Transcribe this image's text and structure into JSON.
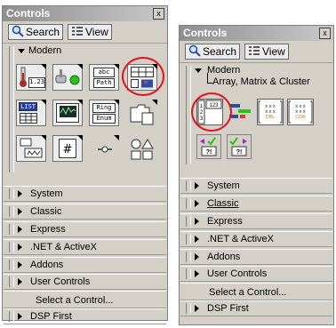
{
  "left_palette": {
    "title": "Controls",
    "close": "x",
    "toolbar": {
      "search_label": "Search",
      "view_label": "View"
    },
    "modern_label": "Modern",
    "icon_labels": {
      "abc": "abc",
      "path": "Path",
      "list": "LIST",
      "ring": "Ring",
      "enum": "Enum",
      "num": "1.23"
    },
    "categories": [
      "System",
      "Classic",
      "Express",
      ".NET & ActiveX",
      "Addons",
      "User Controls"
    ],
    "select_label": "Select a Control...",
    "last_category": "DSP First"
  },
  "right_palette": {
    "title": "Controls",
    "close": "x",
    "toolbar": {
      "search_label": "Search",
      "view_label": "View"
    },
    "modern_label": "Modern",
    "breadcrumb": "Array, Matrix & Cluster",
    "categories": [
      "System",
      "Classic",
      "Express",
      ".NET & ActiveX",
      "Addons",
      "User Controls"
    ],
    "select_label": "Select a Control...",
    "last_category": "DSP First"
  },
  "colors": {
    "highlight_circle": "#e0141e",
    "titlebar": "#9a9a9a",
    "panel": "#d4d0c8"
  }
}
